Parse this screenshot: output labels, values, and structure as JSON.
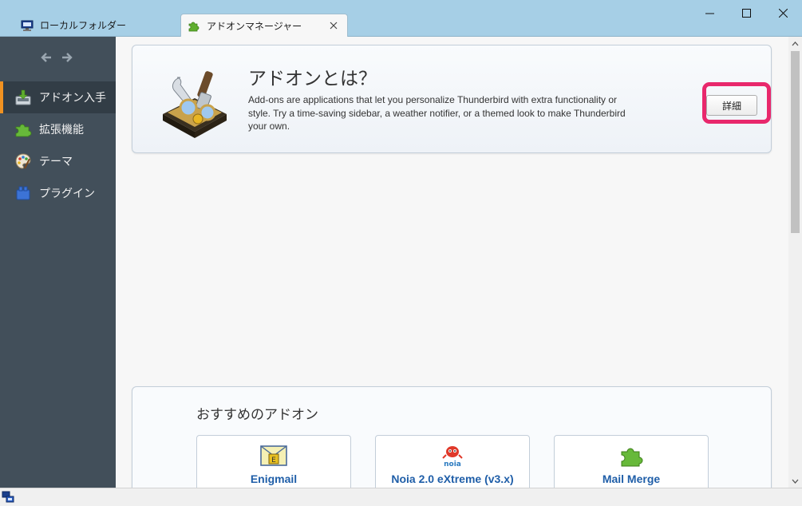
{
  "tabs": [
    {
      "label": "ローカルフォルダー",
      "icon": "computer-icon"
    },
    {
      "label": "アドオンマネージャー",
      "icon": "puzzle-icon",
      "close_icon": "close-icon"
    }
  ],
  "window_controls": [
    "minimize-icon",
    "maximize-icon",
    "close-icon"
  ],
  "sidebar": {
    "nav_icons": [
      "back-arrow-icon",
      "forward-arrow-icon"
    ],
    "items": [
      {
        "label": "アドオン入手",
        "icon": "download-icon",
        "active": true
      },
      {
        "label": "拡張機能",
        "icon": "puzzle-icon"
      },
      {
        "label": "テーマ",
        "icon": "palette-icon"
      },
      {
        "label": "プラグイン",
        "icon": "plugin-icon"
      }
    ]
  },
  "hero": {
    "title": "アドオンとは？",
    "description": "Add-ons are applications that let you personalize Thunderbird with extra functionality or style. Try a time-saving sidebar, a weather notifier, or a themed look to make Thunderbird your own.",
    "details_button": "詳細",
    "highlight_color": "#e8286c"
  },
  "recommended": {
    "title": "おすすめのアドオン",
    "addons": [
      {
        "name": "Enigmail",
        "icon": "enigmail-icon"
      },
      {
        "name": "Noia 2.0 eXtreme (v3.x)",
        "icon": "noia-icon"
      },
      {
        "name": "Mail Merge",
        "icon": "puzzle-icon"
      }
    ]
  },
  "colors": {
    "titlebar": "#a6cfe6",
    "sidebar": "#424f5a",
    "accent": "#f19221",
    "link": "#1f5ea8"
  }
}
